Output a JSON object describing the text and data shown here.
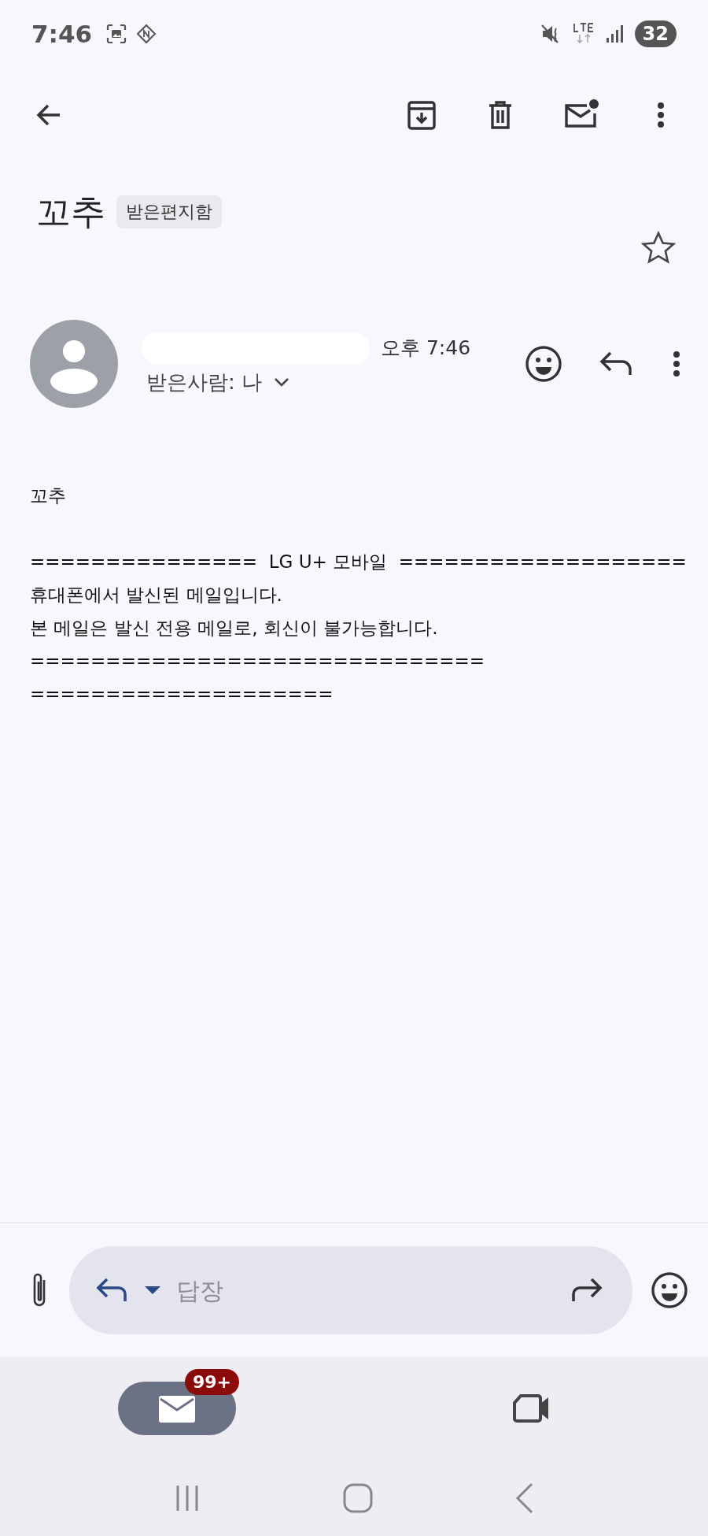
{
  "status_bar": {
    "time": "7:46",
    "battery": "32"
  },
  "subject": {
    "title": "꼬추",
    "label": "받은편지함",
    "starred": false
  },
  "message": {
    "time": "오후 7:46",
    "recipient": "받은사람: 나",
    "greeting": "꼬추",
    "body": [
      "===============  LG U+ 모바일  ===================",
      "휴대폰에서 발신된 메일입니다.",
      "본 메일은 발신 전용 메일로, 회신이 불가능합니다.",
      "==============================",
      "===================="
    ]
  },
  "reply_bar": {
    "placeholder": "답장"
  },
  "bottom_nav": [
    {
      "kind": "mail",
      "selected": true,
      "badge": "99+"
    },
    {
      "kind": "video",
      "selected": false
    }
  ]
}
